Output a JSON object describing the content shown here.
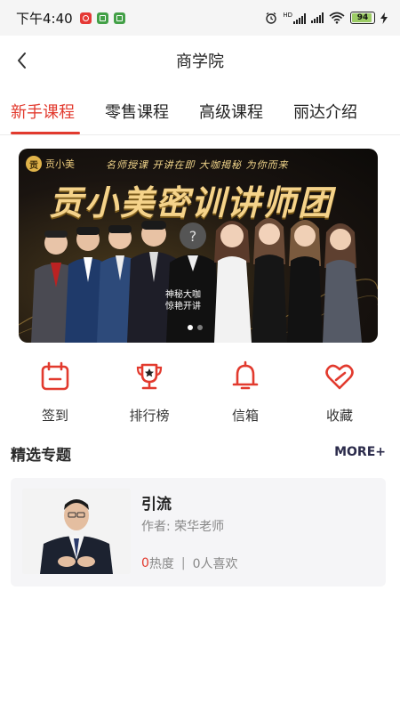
{
  "status_bar": {
    "time": "下午4:40",
    "hd_label": "HD",
    "battery": "94",
    "battery_level": 0.94,
    "app_icons": [
      "weibo-icon",
      "wechat-icon",
      "message-icon"
    ]
  },
  "header": {
    "title": "商学院"
  },
  "tabs": [
    {
      "label": "新手课程",
      "active": true
    },
    {
      "label": "零售课程",
      "active": false
    },
    {
      "label": "高级课程",
      "active": false
    },
    {
      "label": "丽达介绍",
      "active": false
    }
  ],
  "banner": {
    "logo_text": "贡小美",
    "tagline": "名师授课  开讲在即  大咖揭秘  为你而来",
    "title": "贡小美密训讲师团",
    "badge_line1": "神秘大咖",
    "badge_line2": "惊艳开讲",
    "page_count": 2,
    "active_page": 1
  },
  "quick_actions": [
    {
      "label": "签到",
      "icon": "calendar-icon"
    },
    {
      "label": "排行榜",
      "icon": "trophy-icon"
    },
    {
      "label": "信箱",
      "icon": "bell-icon"
    },
    {
      "label": "收藏",
      "icon": "heart-icon"
    }
  ],
  "section": {
    "title": "精选专题",
    "more": "MORE+"
  },
  "course": {
    "title": "引流",
    "author": "作者: 荣华老师",
    "hot_count": "0",
    "hot_label": "热度",
    "separator": "|",
    "likes": "0人喜欢"
  },
  "colors": {
    "accent": "#e23a2e",
    "tab_text": "#222222",
    "card_bg": "#f5f5f7"
  }
}
